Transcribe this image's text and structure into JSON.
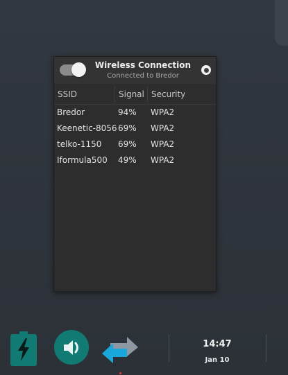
{
  "popup": {
    "title": "Wireless Connection",
    "subtitle": "Connected to Bredor",
    "toggle_state": "on",
    "columns": {
      "ssid": "SSID",
      "signal": "Signal",
      "security": "Security"
    },
    "networks": [
      {
        "ssid": "Bredor",
        "signal": "94%",
        "security": "WPA2"
      },
      {
        "ssid": "Keenetic-8056",
        "signal": "69%",
        "security": "WPA2"
      },
      {
        "ssid": "telko-1150",
        "signal": "69%",
        "security": "WPA2"
      },
      {
        "ssid": "Iformula500",
        "signal": "49%",
        "security": "WPA2"
      }
    ]
  },
  "taskbar": {
    "battery_icon": "battery-charging-icon",
    "volume_icon": "volume-icon",
    "network_icon": "network-transfer-icon",
    "time": "14:47",
    "date": "Jan 10"
  },
  "colors": {
    "accent_teal": "#117a72",
    "popup_bg": "#2d2d2d",
    "desktop_bg": "#2f343b",
    "network_arrow_gray": "#8e98a3",
    "network_arrow_blue": "#1aa7d9"
  }
}
